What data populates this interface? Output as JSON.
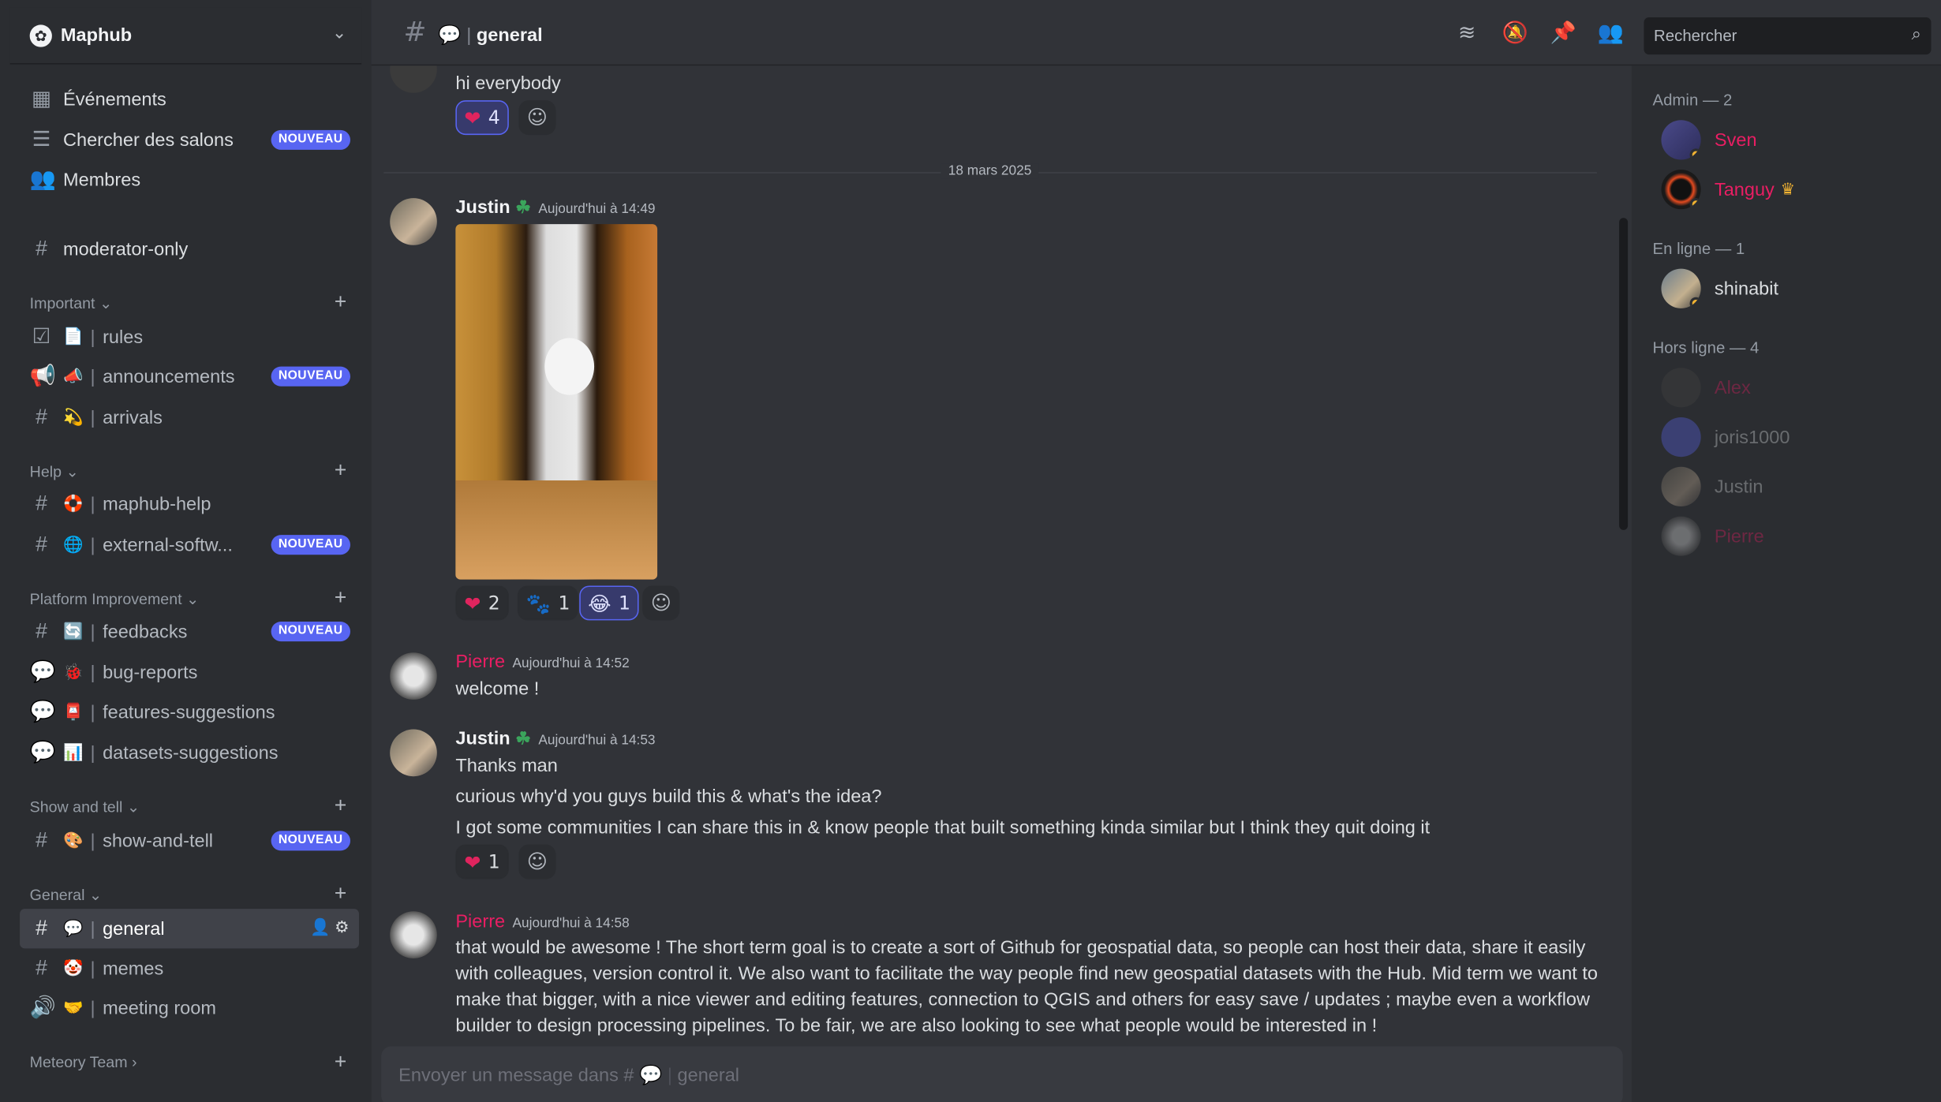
{
  "server": {
    "name": "Maphub"
  },
  "top_items": [
    {
      "label": "Événements"
    },
    {
      "label": "Chercher des salons",
      "badge": "NOUVEAU"
    },
    {
      "label": "Membres"
    }
  ],
  "channels": {
    "moderator": "moderator-only",
    "important": {
      "name": "Important",
      "rules": "rules",
      "announcements": "announcements",
      "arrivals": "arrivals"
    },
    "help": {
      "name": "Help",
      "maphub_help": "maphub-help",
      "external": "external-softw..."
    },
    "platform": {
      "name": "Platform Improvement",
      "feedbacks": "feedbacks",
      "bug_reports": "bug-reports",
      "features": "features-suggestions",
      "datasets": "datasets-suggestions"
    },
    "show": {
      "name": "Show and tell",
      "show_and_tell": "show-and-tell"
    },
    "general": {
      "name": "General",
      "general": "general",
      "memes": "memes",
      "meeting": "meeting room"
    },
    "meteory": {
      "name": "Meteory Team"
    },
    "new_badge": "NOUVEAU"
  },
  "topbar": {
    "channel": "general",
    "search_placeholder": "Rechercher"
  },
  "messages": {
    "m0_text": "hi everybody",
    "m0_react_count": "4",
    "date_divider": "18 mars 2025",
    "m1": {
      "author": "Justin",
      "time": "Aujourd'hui à 14:49",
      "r1": "2",
      "r2": "1",
      "r3": "1"
    },
    "m2": {
      "author": "Pierre",
      "time": "Aujourd'hui à 14:52",
      "text": "welcome !"
    },
    "m3": {
      "author": "Justin",
      "time": "Aujourd'hui à 14:53",
      "l1": "Thanks man",
      "l2": "curious why'd you guys build this & what's the idea?",
      "l3": "I got some communities I can share this in & know people that built something kinda similar but I think they quit doing it",
      "r1": "1"
    },
    "m4": {
      "author": "Pierre",
      "time": "Aujourd'hui à 14:58",
      "l1": "that would be awesome ! The short term goal is to create a sort of Github for geospatial data, so people can host their data, share it easily",
      "l2": "with colleagues, version control it. We also want to facilitate the way people find new geospatial datasets with the Hub. Mid term we want to",
      "l3": "make that bigger, with a nice viewer and editing features, connection to QGIS and others for easy save / updates ; maybe even a workflow",
      "l4": "builder to design processing pipelines. To be fair, we are also looking to see what people would be interested in !"
    }
  },
  "composer": {
    "placeholder_prefix": "Envoyer un message dans #",
    "placeholder_channel": "general"
  },
  "members": {
    "admin_header": "Admin — 2",
    "online_header": "En ligne — 1",
    "offline_header": "Hors ligne — 4",
    "admins": [
      "Sven",
      "Tanguy"
    ],
    "online": [
      "shinabit"
    ],
    "offline": [
      "Alex",
      "joris1000",
      "Justin",
      "Pierre"
    ]
  },
  "colors": {
    "accent": "#5865f2",
    "pierre": "#e91e63",
    "justin": "#f2f3f5",
    "admin": "#e91e63",
    "background": "#313338",
    "sidebar": "#2b2d31"
  }
}
